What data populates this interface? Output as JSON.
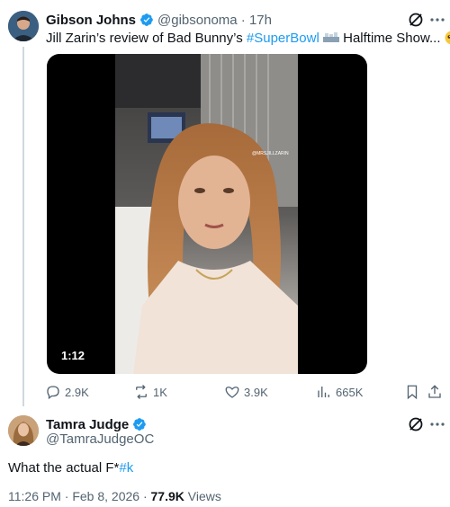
{
  "parent_tweet": {
    "author_name": "Gibson Johns",
    "handle_time": "@gibsonoma · 17h",
    "text_before": "Jill Zarin’s review of Bad Bunny’s ",
    "hashtag": "#SuperBowl",
    "text_after": " Halftime Show...",
    "video": {
      "duration": "1:12",
      "watermark": "@MRSJILLZARIN"
    },
    "actions": {
      "replies": "2.9K",
      "reposts": "1K",
      "likes": "3.9K",
      "views": "665K"
    }
  },
  "reply_tweet": {
    "author_name": "Tamra Judge",
    "handle": "@TamraJudgeOC",
    "text_before": "What the actual F*",
    "hashtag": "#k",
    "time_date": "11:26 PM · Feb 8, 2026 · ",
    "views_count": "77.9K",
    "views_label": " Views"
  },
  "icons": {
    "verified": "verified-badge-icon",
    "grok": "grok-icon",
    "more": "more-icon",
    "reply": "reply-icon",
    "repost": "repost-icon",
    "like": "like-icon",
    "views": "views-icon",
    "bookmark": "bookmark-icon",
    "share": "share-icon",
    "football": "football-emoji-icon",
    "emoji": "pleading-face-emoji-icon"
  },
  "colors": {
    "accent": "#1d9bf0",
    "secondary_text": "#536471",
    "primary_text": "#0f1419",
    "thread_line": "#cfd9de"
  }
}
